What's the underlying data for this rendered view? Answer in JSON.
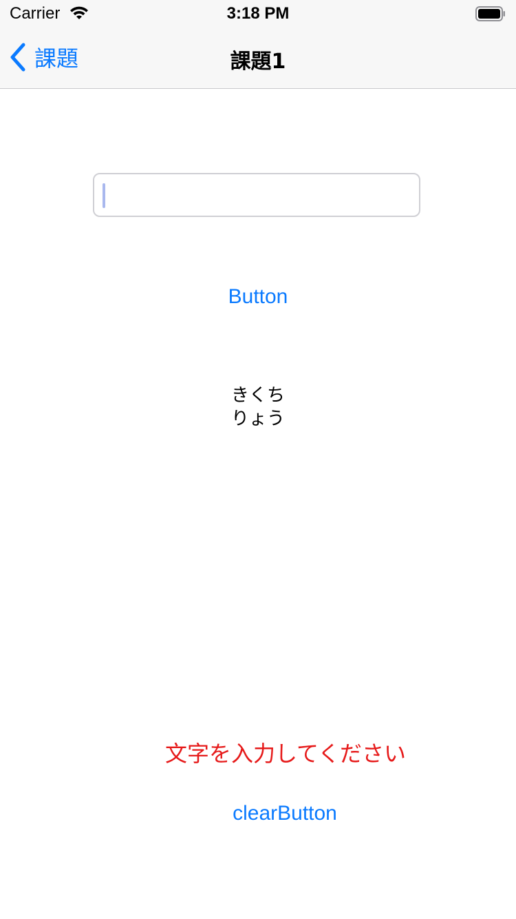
{
  "status_bar": {
    "carrier": "Carrier",
    "time": "3:18 PM"
  },
  "nav": {
    "back_label": "課題",
    "title": "課題1"
  },
  "text_field": {
    "value": "",
    "placeholder": ""
  },
  "button": {
    "label": "Button"
  },
  "name_label": {
    "line1": "きくち",
    "line2": "りょう"
  },
  "error_label": {
    "text": "文字を入力してください"
  },
  "clear_button": {
    "label": "clearButton"
  },
  "colors": {
    "accent": "#0a7aff",
    "error": "#e61a1a",
    "bar_background": "#f7f7f7"
  }
}
